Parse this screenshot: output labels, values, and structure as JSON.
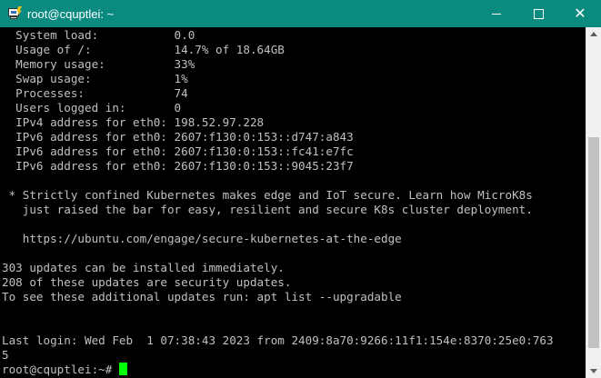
{
  "window": {
    "title": "root@cquptlei: ~",
    "accent_color": "#0b8a80"
  },
  "controls": {
    "minimize": "minimize-icon",
    "maximize": "maximize-icon",
    "close": "close-icon"
  },
  "terminal": {
    "lines": [
      "  System load:           0.0",
      "  Usage of /:            14.7% of 18.64GB",
      "  Memory usage:          33%",
      "  Swap usage:            1%",
      "  Processes:             74",
      "  Users logged in:       0",
      "  IPv4 address for eth0: 198.52.97.228",
      "  IPv6 address for eth0: 2607:f130:0:153::d747:a843",
      "  IPv6 address for eth0: 2607:f130:0:153::fc41:e7fc",
      "  IPv6 address for eth0: 2607:f130:0:153::9045:23f7",
      "",
      " * Strictly confined Kubernetes makes edge and IoT secure. Learn how MicroK8s",
      "   just raised the bar for easy, resilient and secure K8s cluster deployment.",
      "",
      "   https://ubuntu.com/engage/secure-kubernetes-at-the-edge",
      "",
      "303 updates can be installed immediately.",
      "208 of these updates are security updates.",
      "To see these additional updates run: apt list --upgradable",
      "",
      "",
      "Last login: Wed Feb  1 07:38:43 2023 from 2409:8a70:9266:11f1:154e:8370:25e0:763",
      "5"
    ],
    "prompt": "root@cquptlei:~# ",
    "cursor_color": "#00ff00"
  }
}
